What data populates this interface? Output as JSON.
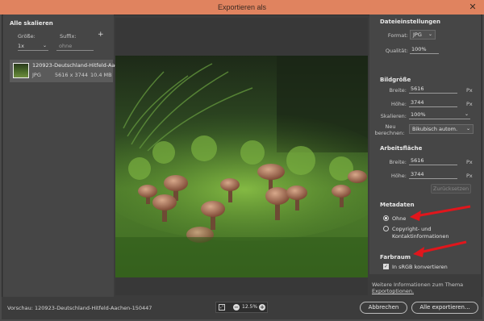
{
  "window": {
    "title": "Exportieren als",
    "close_glyph": "✕"
  },
  "left_panel": {
    "heading": "Alle skalieren",
    "size_label": "Größe:",
    "suffix_label": "Suffix:",
    "add_glyph": "+",
    "size_value": "1x",
    "suffix_placeholder": "ohne",
    "file": {
      "name": "120923-Deutschland-Hitfeld-Aac...",
      "type": "JPG",
      "dimensions": "5616 x 3744",
      "size": "10.4 MB"
    }
  },
  "right_panel": {
    "file_settings": {
      "heading": "Dateieinstellungen",
      "format_label": "Format:",
      "format_value": "JPG",
      "quality_label": "Qualität:",
      "quality_value": "100%"
    },
    "image_size": {
      "heading": "Bildgröße",
      "width_label": "Breite:",
      "width_value": "5616",
      "height_label": "Höhe:",
      "height_value": "3744",
      "scale_label": "Skalieren:",
      "scale_value": "100%",
      "resample_label_1": "Neu",
      "resample_label_2": "berechnen:",
      "resample_value": "Bikubisch autom.",
      "unit": "Px"
    },
    "canvas": {
      "heading": "Arbeitsfläche",
      "width_label": "Breite:",
      "width_value": "5616",
      "height_label": "Höhe:",
      "height_value": "3744",
      "unit": "Px",
      "reset_label": "Zurücksetzen"
    },
    "metadata": {
      "heading": "Metadaten",
      "option_none": "Ohne",
      "option_copyright_1": "Copyright- und",
      "option_copyright_2": "Kontaktinformationen",
      "selected": "Ohne"
    },
    "color_space": {
      "heading": "Farbraum",
      "convert_label": "In sRGB konvertieren",
      "convert_checked": true
    },
    "info_text": "Weitere Informationen zum Thema",
    "info_link": "Exportoptionen."
  },
  "bottom": {
    "preview_label": "Vorschau: 120923-Deutschland-Hitfeld-Aachen-150447",
    "zoom_fit_glyph": "⤢",
    "zoom_minus_glyph": "−",
    "zoom_plus_glyph": "+",
    "zoom_value": "12.5%",
    "cancel_label": "Abbrechen",
    "export_label": "Alle exportieren..."
  },
  "colors": {
    "titlebar": "#e0835f",
    "annotation_arrow": "#e0161c"
  },
  "icons": {
    "close": "close-icon",
    "add": "plus-icon",
    "zoom_fit": "fit-screen-icon",
    "zoom_out": "zoom-out-icon",
    "zoom_in": "zoom-in-icon",
    "chevron": "chevron-down-icon",
    "thumbnail": "image-thumbnail"
  }
}
